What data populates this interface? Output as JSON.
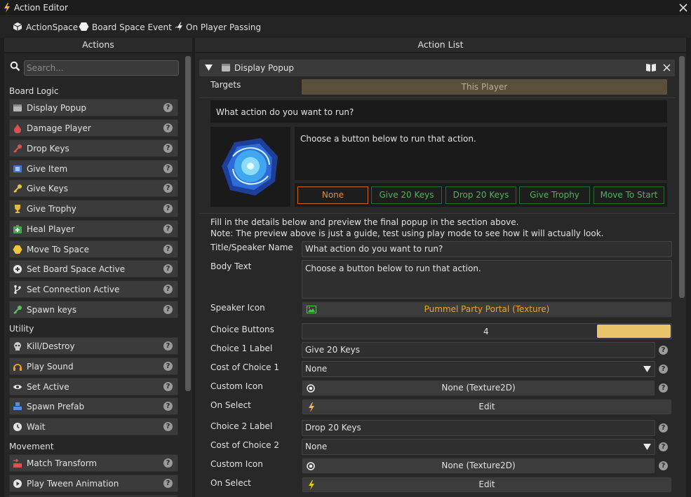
{
  "window": {
    "title": "Action Editor"
  },
  "breadcrumb": {
    "part1": "ActionSpace",
    "part2": "Board Space Event ~",
    "part3": "On Player Passing"
  },
  "left": {
    "header": "Actions",
    "search_placeholder": "Search...",
    "sections": {
      "board_logic": "Board Logic",
      "utility": "Utility",
      "movement": "Movement"
    },
    "board_logic_items": [
      "Display Popup",
      "Damage Player",
      "Drop Keys",
      "Give Item",
      "Give Keys",
      "Give Trophy",
      "Heal Player",
      "Move To Space",
      "Set Board Space Active",
      "Set Connection Active",
      "Spawn keys"
    ],
    "utility_items": [
      "Kill/Destroy",
      "Play Sound",
      "Set Active",
      "Spawn Prefab",
      "Wait"
    ],
    "movement_items": [
      "Match Transform",
      "Play Tween Animation"
    ]
  },
  "right": {
    "header": "Action List",
    "card_title": "Display Popup",
    "targets_label": "Targets",
    "targets_value": "This Player",
    "preview": {
      "title": "What action do you want to run?",
      "body": "Choose a button below to run that action.",
      "buttons": [
        "None",
        "Give 20 Keys",
        "Drop 20 Keys",
        "Give Trophy",
        "Move To Start"
      ]
    },
    "note_line1": "Fill in the details below and preview the final popup in the section above.",
    "note_line2": "Note: The preview above is just a guide, test using play mode to see how it will actually look.",
    "title_label": "Title/Speaker Name",
    "title_value": "What action do you want to run?",
    "body_label": "Body Text",
    "body_value": "Choose a button below to run that action.",
    "speaker_icon_label": "Speaker Icon",
    "speaker_icon_value": "Pummel Party Portal (Texture)",
    "choice_buttons_label": "Choice Buttons",
    "choice_buttons_value": "4",
    "choice_buttons_fraction": 0.2,
    "choice1_label": "Choice 1 Label",
    "choice1_value": "Give 20 Keys",
    "cost1_label": "Cost of Choice 1",
    "cost1_value": "None",
    "custom_icon1_label": "Custom Icon",
    "custom_icon1_value": "None (Texture2D)",
    "onselect1_label": "On Select",
    "onselect1_value": "Edit",
    "choice2_label": "Choice 2 Label",
    "choice2_value": "Drop 20 Keys",
    "cost2_label": "Cost of Choice 2",
    "cost2_value": "None",
    "custom_icon2_label": "Custom Icon",
    "custom_icon2_value": "None (Texture2D)",
    "onselect2_label": "On Select",
    "onselect2_value": "Edit"
  },
  "colors": {
    "accent_orange": "#e8a43a",
    "accent_green": "#4fb35a",
    "slider_yellow": "#e9c46a",
    "target_bar": "#5b4f3c"
  }
}
